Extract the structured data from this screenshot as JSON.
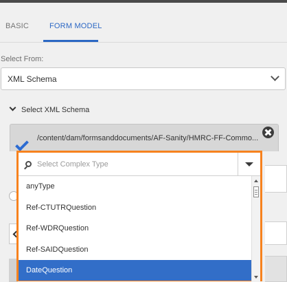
{
  "tabs": [
    {
      "label": "BASIC",
      "active": false
    },
    {
      "label": "FORM MODEL",
      "active": true
    }
  ],
  "select_from": {
    "label": "Select From:",
    "value": "XML Schema"
  },
  "xml_schema_section": {
    "title": "Select XML Schema",
    "path": "/content/dam/formsanddocuments/AF-Sanity/HMRC-FF-Commo..."
  },
  "complex_type": {
    "placeholder": "Select Complex Type",
    "options": [
      "anyType",
      "Ref-CTUTRQuestion",
      "Ref-WDRQuestion",
      "Ref-SAIDQuestion",
      "DateQuestion"
    ],
    "selected": "DateQuestion"
  },
  "icons": {
    "checkmark": "checkmark-icon",
    "clear": "close-icon",
    "search": "search-icon",
    "dropdown": "caret-down-icon"
  },
  "colors": {
    "accent": "#2b67c4",
    "highlight_border": "#f7821e",
    "selected_bg": "#326ec8"
  }
}
